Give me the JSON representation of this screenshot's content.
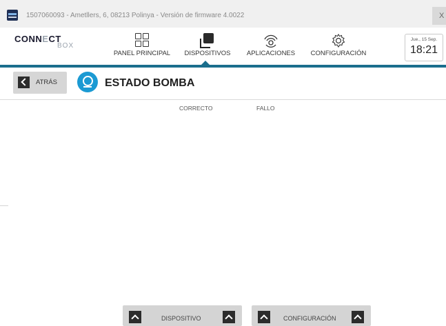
{
  "window": {
    "title": "1507060093 - Ametllers, 6, 08213 Polinya - Versión de firmware 4.0022",
    "close_label": "X"
  },
  "brand": {
    "name_dark": "CONN",
    "name_light": "E",
    "name_end": "CT",
    "sub": "BOX"
  },
  "nav": {
    "items": [
      {
        "label": "PANEL PRINCIPAL",
        "icon": "grid-icon"
      },
      {
        "label": "DISPOSITIVOS",
        "icon": "squares-icon",
        "active": true
      },
      {
        "label": "APLICACIONES",
        "icon": "signal-icon"
      },
      {
        "label": "CONFIGURACIÓN",
        "icon": "gear-icon"
      }
    ],
    "active_color": "#1a6e8d"
  },
  "clock": {
    "date": "Jue., 15 Sep.",
    "time": "18:21"
  },
  "subheader": {
    "back_label": "ATRÁS",
    "title": "ESTADO BOMBA",
    "icon_color": "#1b9ad3"
  },
  "table": {
    "headers": [
      "CORRECTO",
      "FALLO"
    ]
  },
  "footer": {
    "buttons": [
      {
        "label": "DISPOSITIVO"
      },
      {
        "label": "CONFIGURACIÓN"
      }
    ]
  }
}
